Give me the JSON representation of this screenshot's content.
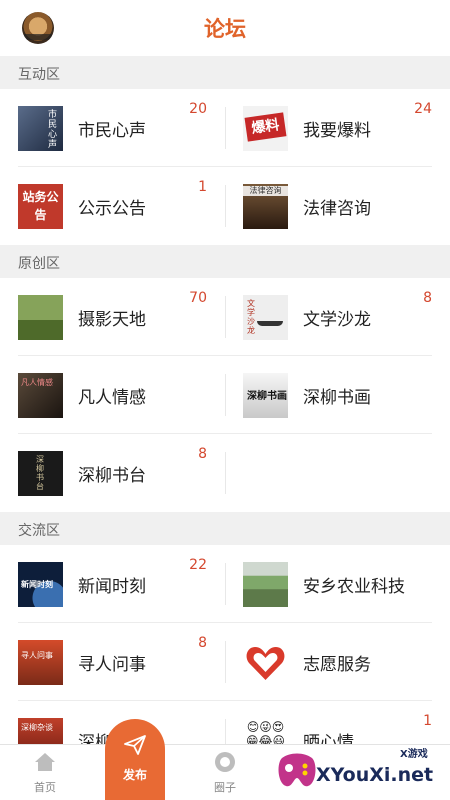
{
  "header": {
    "title": "论坛"
  },
  "sections": [
    {
      "title": "互动区"
    },
    {
      "title": "原创区"
    },
    {
      "title": "交流区"
    }
  ],
  "forums": {
    "citizen": {
      "label": "市民心声",
      "count": "20",
      "thumb_text": "市民心声"
    },
    "baoliao": {
      "label": "我要爆料",
      "count": "24",
      "thumb_text": "爆料"
    },
    "gongshi": {
      "label": "公示公告",
      "count": "1",
      "thumb_text": "站务公告"
    },
    "law": {
      "label": "法律咨询",
      "count": "",
      "thumb_text": "法律咨询"
    },
    "photo": {
      "label": "摄影天地",
      "count": "70"
    },
    "wenxue": {
      "label": "文学沙龙",
      "count": "8",
      "thumb_text": "文学沙龙"
    },
    "fanren": {
      "label": "凡人情感",
      "count": "",
      "thumb_text": "凡人情感"
    },
    "shuhua": {
      "label": "深柳书画",
      "count": "",
      "thumb_text": "深柳书画"
    },
    "shutai": {
      "label": "深柳书台",
      "count": "8",
      "thumb_text": "深柳书台"
    },
    "news": {
      "label": "新闻时刻",
      "count": "22",
      "thumb_text": "新闻时刻"
    },
    "farm": {
      "label": "安乡农业科技",
      "count": ""
    },
    "xunren": {
      "label": "寻人问事",
      "count": "8",
      "thumb_text": "寻人问事"
    },
    "volunteer": {
      "label": "志愿服务",
      "count": ""
    },
    "cha": {
      "label": "深柳茶",
      "count": "",
      "thumb_text": "深柳杂谈"
    },
    "mood": {
      "label": "晒心情",
      "count": "1",
      "thumb_text": "😊😜😍😁😂😃😎😏😐"
    }
  },
  "nav": {
    "home": "首页",
    "publish": "发布",
    "circle": "圈子"
  },
  "watermark": {
    "text": "XYouXi.net",
    "sub": "X游戏"
  },
  "colors": {
    "accent": "#e0632a",
    "count": "#d4482f",
    "section_bg": "#f0f0f0"
  },
  "icons": {
    "home": "home-icon",
    "publish": "paper-plane-icon",
    "circle": "chat-bubble-icon"
  }
}
